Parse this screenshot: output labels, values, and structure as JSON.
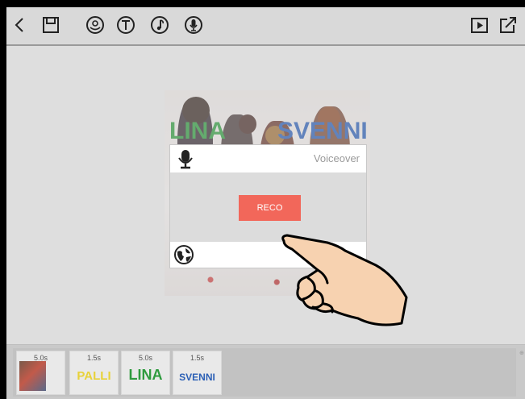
{
  "toolbar": {
    "back": "back-icon",
    "save": "save-icon",
    "sticker": "sticker-icon",
    "text": "text-icon",
    "music": "music-icon",
    "voiceover": "microphone-icon",
    "play": "play-icon",
    "share": "share-icon"
  },
  "preview": {
    "overlay_words": [
      "LINA",
      "SVENNI"
    ]
  },
  "dialog": {
    "title": "Voiceover",
    "record_label": "RECO"
  },
  "timeline": {
    "clips": [
      {
        "duration": "5.0s",
        "type": "image"
      },
      {
        "duration": "1.5s",
        "word": "PALLI",
        "color": "#e8d23a"
      },
      {
        "duration": "5.0s",
        "word": "LINA",
        "color": "#2e9b3e"
      },
      {
        "duration": "1.5s",
        "word": "SVENNI",
        "color": "#2b5fb5"
      }
    ]
  },
  "colors": {
    "record_button": "#f2675a",
    "toolbar_bg": "#d9d9d9",
    "canvas_bg": "#dedede"
  }
}
